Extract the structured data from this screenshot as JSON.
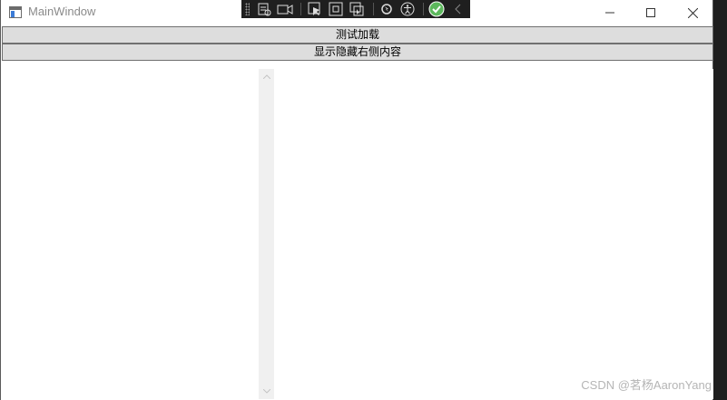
{
  "window": {
    "title": "MainWindow"
  },
  "buttons": {
    "test_load": "测试加载",
    "toggle_right": "显示隐藏右侧内容"
  },
  "devtools": {
    "icons": [
      "live-visual-tree-icon",
      "record-icon",
      "select-element-icon",
      "display-layout-adorners-icon",
      "track-focus-icon",
      "hot-reload-icon",
      "accessibility-icon",
      "binding-check-icon",
      "collapse-toolbar-icon"
    ]
  },
  "watermark": "CSDN @茗杨AaronYang",
  "colors": {
    "button_bg": "#dddddd",
    "scrollbar_bg": "#f0f0f0",
    "devbar_bg": "#1f1f1f",
    "check_green": "#5cb85c"
  }
}
